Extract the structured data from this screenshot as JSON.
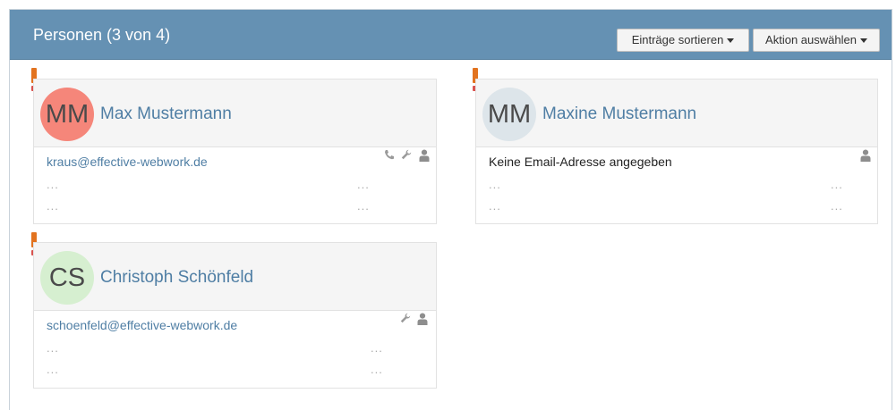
{
  "panel": {
    "title": "Personen (3 von 4)",
    "sort_button": "Einträge sortieren",
    "action_button": "Aktion auswählen"
  },
  "persons": [
    {
      "initials": "MM",
      "name": "Max Mustermann",
      "email": "kraus@effective-webwork.de",
      "avatar_color": "#f5867a",
      "placeholder": "..."
    },
    {
      "initials": "MM",
      "name": "Maxine Mustermann",
      "email_text": "Keine Email-Adresse angegeben",
      "avatar_color": "#dde5ea",
      "placeholder": "..."
    },
    {
      "initials": "CS",
      "name": "Christoph Schönfeld",
      "email": "schoenfeld@effective-webwork.de",
      "avatar_color": "#d6efd0",
      "placeholder": "..."
    }
  ],
  "colors": {
    "header_bg": "#6591b3",
    "link": "#4f7ea4",
    "warning": "#e2731f"
  }
}
